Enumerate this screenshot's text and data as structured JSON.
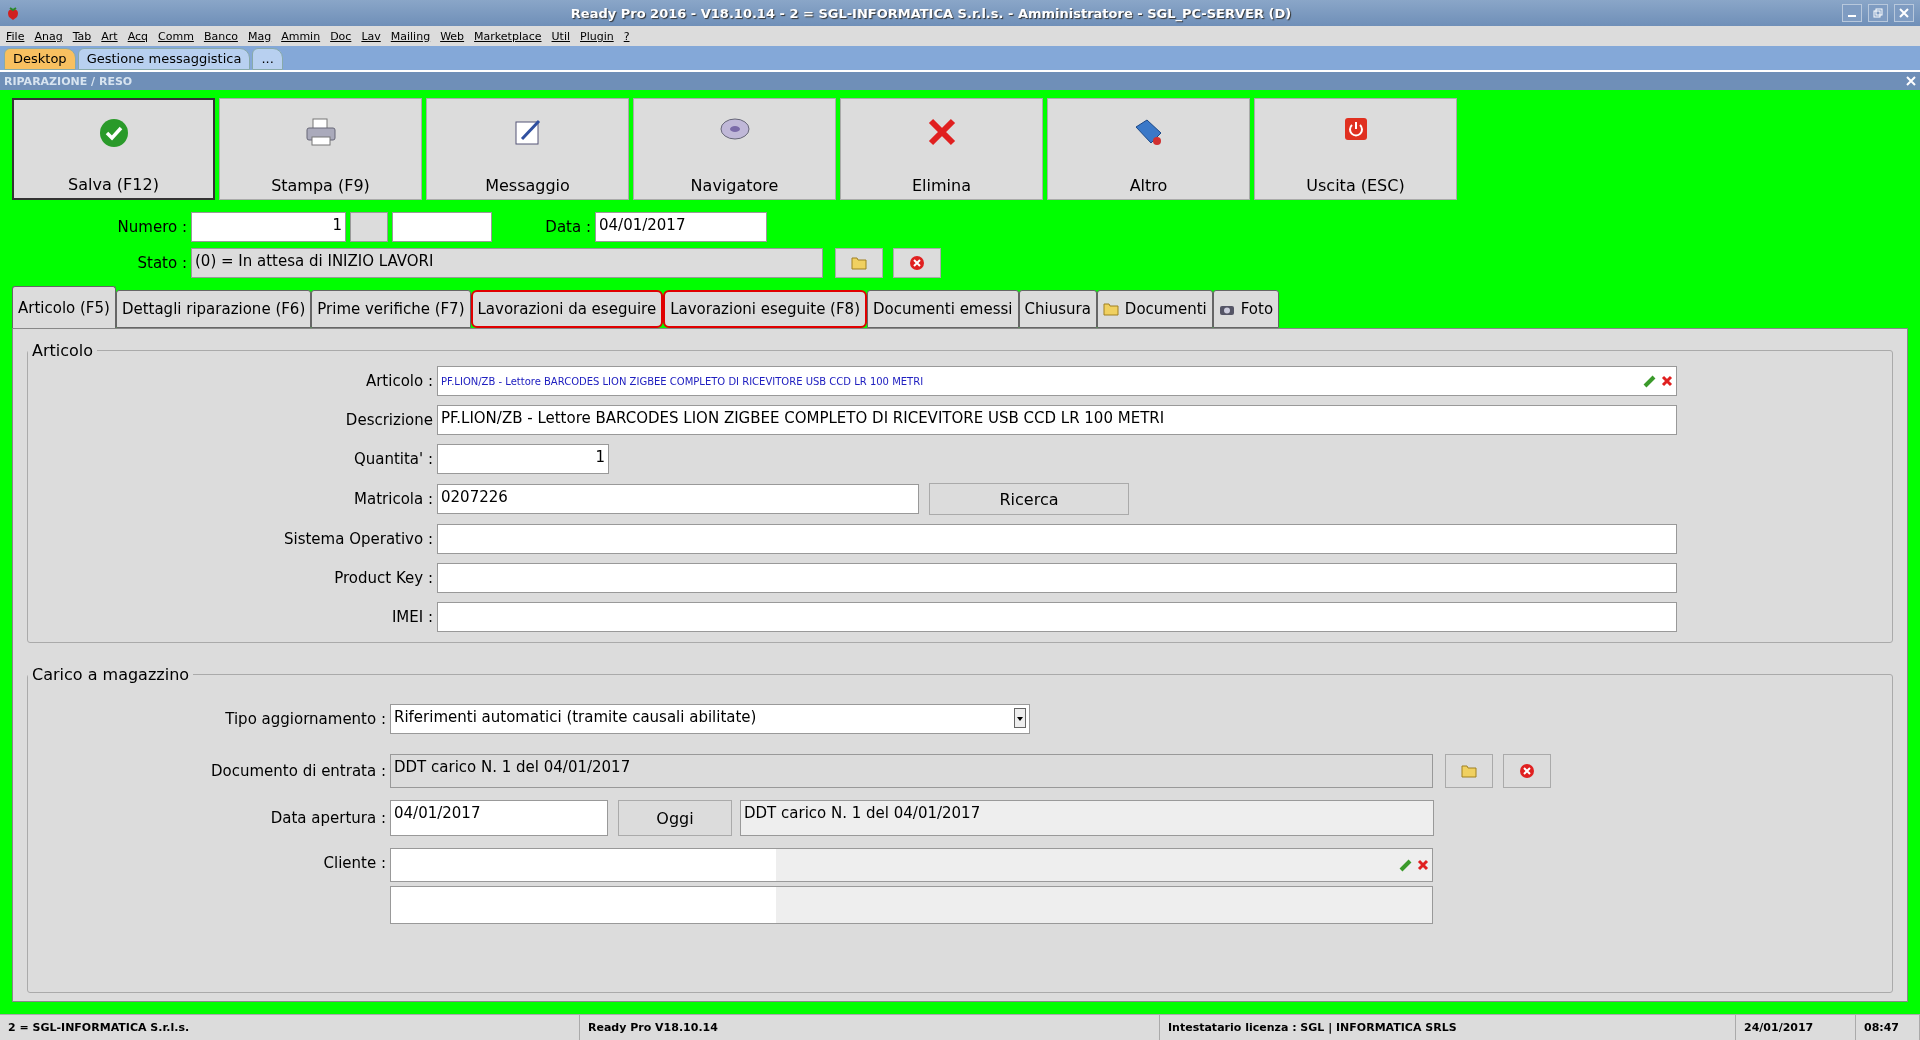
{
  "window": {
    "title": "Ready Pro 2016 - V18.10.14 - 2 = SGL-INFORMATICA S.r.l.s. - Amministratore - SGL_PC-SERVER (D)"
  },
  "menu": [
    "File",
    "Anag",
    "Tab",
    "Art",
    "Acq",
    "Comm",
    "Banco",
    "Mag",
    "Ammin",
    "Doc",
    "Lav",
    "Mailing",
    "Web",
    "Marketplace",
    "Util",
    "Plugin",
    "?"
  ],
  "doc_tabs": [
    {
      "label": "Desktop",
      "selected": true
    },
    {
      "label": "Gestione messaggistica",
      "selected": false
    },
    {
      "label": "...",
      "selected": false
    }
  ],
  "section_title": "RIPARAZIONE / RESO",
  "toolbar": [
    {
      "label": "Salva (F12)",
      "kind": "check",
      "pressed": true
    },
    {
      "label": "Stampa (F9)",
      "kind": "printer",
      "pressed": false
    },
    {
      "label": "Messaggio",
      "kind": "message",
      "pressed": false
    },
    {
      "label": "Navigatore",
      "kind": "disc",
      "pressed": false
    },
    {
      "label": "Elimina",
      "kind": "delete",
      "pressed": false
    },
    {
      "label": "Altro",
      "kind": "tag",
      "pressed": false
    },
    {
      "label": "Uscita (ESC)",
      "kind": "power",
      "pressed": false
    }
  ],
  "header": {
    "numero_label": "Numero :",
    "numero": "1",
    "data_label": "Data :",
    "data": "04/01/2017",
    "stato_label": "Stato :",
    "stato": "(0) = In attesa di INIZIO LAVORI"
  },
  "tabs": [
    {
      "label": "Articolo (F5)",
      "selected": true,
      "highlighted": false
    },
    {
      "label": "Dettagli riparazione (F6)",
      "selected": false,
      "highlighted": false
    },
    {
      "label": "Prime verifiche (F7)",
      "selected": false,
      "highlighted": false
    },
    {
      "label": "Lavorazioni da eseguire",
      "selected": false,
      "highlighted": true
    },
    {
      "label": "Lavorazioni eseguite  (F8)",
      "selected": false,
      "highlighted": true
    },
    {
      "label": "Documenti emessi",
      "selected": false,
      "highlighted": false
    },
    {
      "label": "Chiusura",
      "selected": false,
      "highlighted": false
    },
    {
      "label": "Documenti",
      "selected": false,
      "highlighted": false,
      "kind": "folder"
    },
    {
      "label": "Foto",
      "selected": false,
      "highlighted": false,
      "kind": "camera"
    }
  ],
  "articolo": {
    "title": "Articolo",
    "fields": [
      {
        "kind": "lookup",
        "label": "Articolo :",
        "value": "PF.LION/ZB - Lettore BARCODES LION ZIGBEE COMPLETO DI RICEVITORE USB CCD LR 100 METRI"
      },
      {
        "kind": "text",
        "label": "Descrizione",
        "value": "PF.LION/ZB - Lettore BARCODES LION ZIGBEE COMPLETO DI RICEVITORE USB CCD LR 100 METRI"
      },
      {
        "kind": "number",
        "label": "Quantita' :",
        "value": "1"
      },
      {
        "kind": "search",
        "label": "Matricola :",
        "value": "0207226",
        "button": "Ricerca"
      },
      {
        "kind": "text",
        "label": "Sistema Operativo :"
      },
      {
        "kind": "text",
        "label": "Product Key :"
      },
      {
        "kind": "text",
        "label": "IMEI :"
      }
    ]
  },
  "carico": {
    "title": "Carico a magazzino",
    "tipo_label": "Tipo aggiornamento :",
    "tipo": "Riferimenti automatici (tramite causali abilitate)",
    "documento_label": "Documento di entrata :",
    "documento": "DDT carico N. 1 del 04/01/2017",
    "apertura_label": "Data apertura :",
    "apertura": "04/01/2017",
    "oggi": "Oggi",
    "apertura_doc": "DDT carico N. 1 del 04/01/2017",
    "cliente_label": "Cliente :"
  },
  "status_bar": [
    "2 = SGL-INFORMATICA S.r.l.s.",
    "Ready Pro V18.10.14",
    "Intestatario licenza : SGL | INFORMATICA SRLS",
    "24/01/2017",
    "08:47"
  ]
}
